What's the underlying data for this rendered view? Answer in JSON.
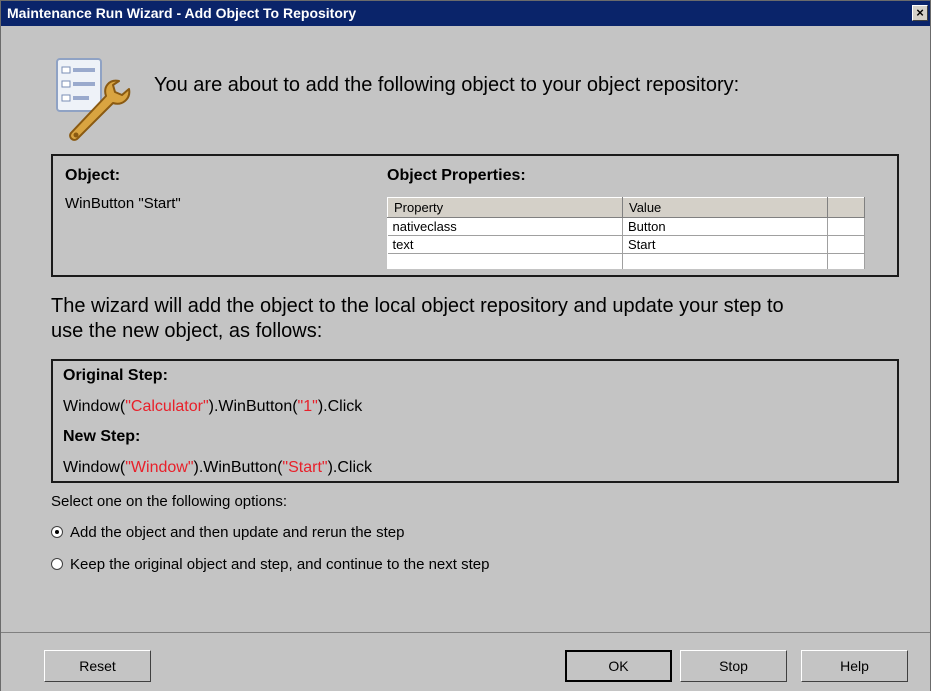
{
  "window": {
    "title": "Maintenance Run Wizard - Add Object To Repository",
    "close_glyph": "×",
    "icon": "close-icon"
  },
  "header": {
    "icon": "wrench-form-icon",
    "intro": "You are about to add the following object to your object repository:"
  },
  "object_panel": {
    "object_label": "Object:",
    "object_value": "WinButton \"Start\"",
    "properties_label": "Object Properties:",
    "columns": [
      "Property",
      "Value"
    ],
    "rows": [
      {
        "property": "nativeclass",
        "value": "Button"
      },
      {
        "property": "text",
        "value": "Start"
      }
    ]
  },
  "wizard_description": "The wizard will add the object to the local object repository and update your step to use the new object, as follows:",
  "steps": {
    "original_label": "Original Step:",
    "original": {
      "prefix": "Window(",
      "arg1": "\"Calculator\"",
      "mid": ").WinButton(",
      "arg2": "\"1\"",
      "suffix": ").Click"
    },
    "new_label": "New Step:",
    "new": {
      "prefix": "Window(",
      "arg1": "\"Window\"",
      "mid": ").WinButton(",
      "arg2": "\"Start\"",
      "suffix": ").Click"
    }
  },
  "options": {
    "label": "Select one on the following options:",
    "items": [
      {
        "label": "Add the object and then update and rerun the step",
        "selected": true
      },
      {
        "label": "Keep the original object and step, and continue to the next step",
        "selected": false
      }
    ]
  },
  "buttons": {
    "reset": "Reset",
    "ok": "OK",
    "stop": "Stop",
    "help": "Help"
  },
  "colors": {
    "title_bar": "#0a246a",
    "window_bg": "#c4c4c4",
    "string_literal": "#e8202a"
  }
}
